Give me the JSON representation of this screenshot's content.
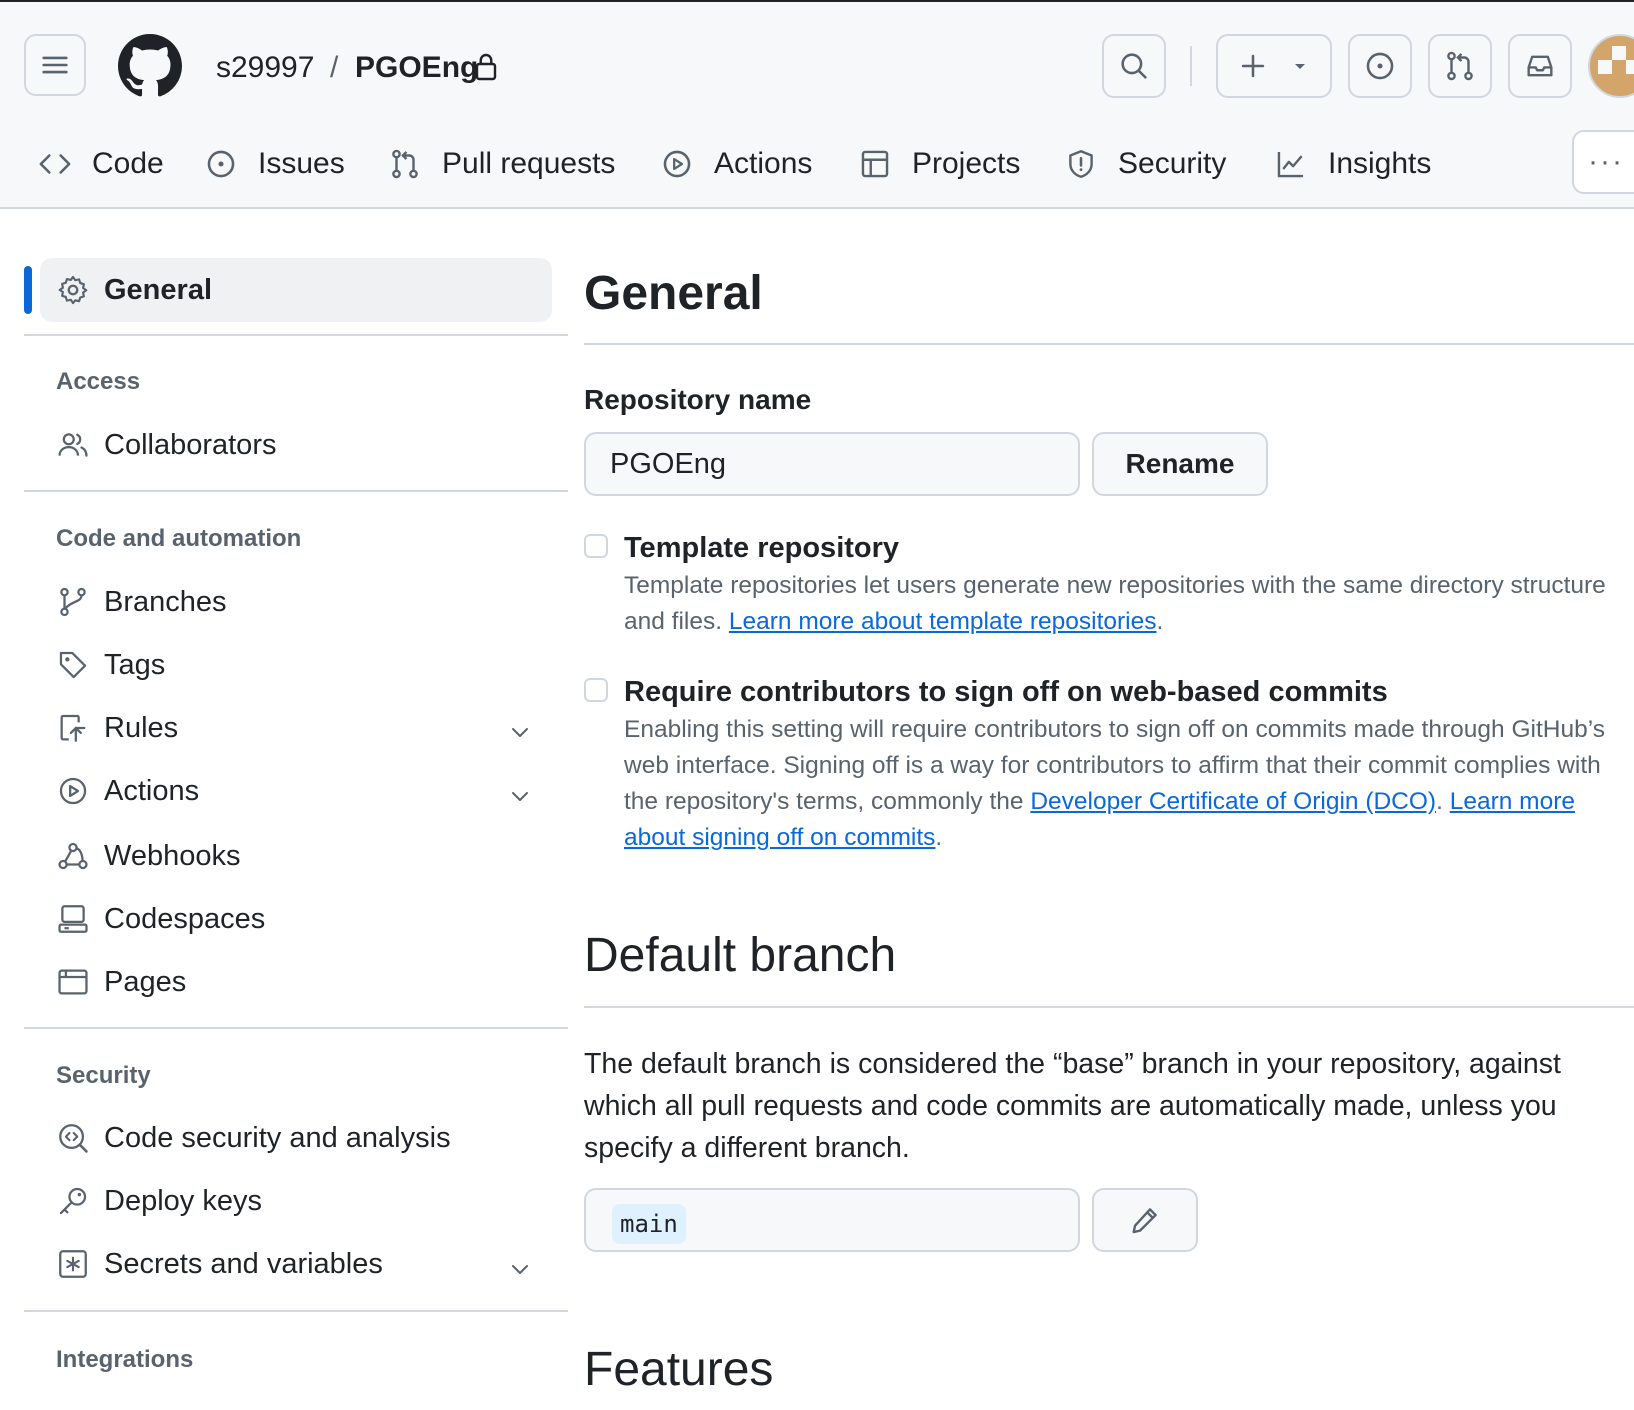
{
  "header": {
    "owner": "s29997",
    "separator": "/",
    "repo": "PGOEng"
  },
  "tabs": [
    {
      "label": "Code",
      "icon": "code-icon"
    },
    {
      "label": "Issues",
      "icon": "issue-opened-icon"
    },
    {
      "label": "Pull requests",
      "icon": "git-pull-request-icon"
    },
    {
      "label": "Actions",
      "icon": "play-icon"
    },
    {
      "label": "Projects",
      "icon": "table-icon"
    },
    {
      "label": "Security",
      "icon": "shield-icon"
    },
    {
      "label": "Insights",
      "icon": "graph-icon"
    }
  ],
  "more_label": "···",
  "sidebar": {
    "general": "General",
    "access_heading": "Access",
    "collaborators": "Collaborators",
    "code_heading": "Code and automation",
    "branches": "Branches",
    "tags": "Tags",
    "rules": "Rules",
    "actions": "Actions",
    "webhooks": "Webhooks",
    "codespaces": "Codespaces",
    "pages": "Pages",
    "security_heading": "Security",
    "code_security": "Code security and analysis",
    "deploy_keys": "Deploy keys",
    "secrets": "Secrets and variables",
    "integrations_heading": "Integrations"
  },
  "main": {
    "title": "General",
    "repo_name_label": "Repository name",
    "repo_name_value": "PGOEng",
    "rename_label": "Rename",
    "template_title": "Template repository",
    "template_desc": "Template repositories let users generate new repositories with the same directory structure and files. ",
    "template_link": "Learn more about template repositories",
    "template_end": ".",
    "signoff_title": "Require contributors to sign off on web-based commits",
    "signoff_desc": "Enabling this setting will require contributors to sign off on commits made through GitHub’s web interface. Signing off is a way for contributors to affirm that their commit complies with the repository's terms, commonly the ",
    "signoff_link1": "Developer Certificate of Origin (DCO)",
    "signoff_mid": ". ",
    "signoff_link2": "Learn more about signing off on commits",
    "signoff_end": ".",
    "default_branch_title": "Default branch",
    "default_branch_desc": "The default branch is considered the “base” branch in your repository, against which all pull requests and code commits are automatically made, unless you specify a different branch.",
    "default_branch_value": "main",
    "features_title": "Features"
  }
}
